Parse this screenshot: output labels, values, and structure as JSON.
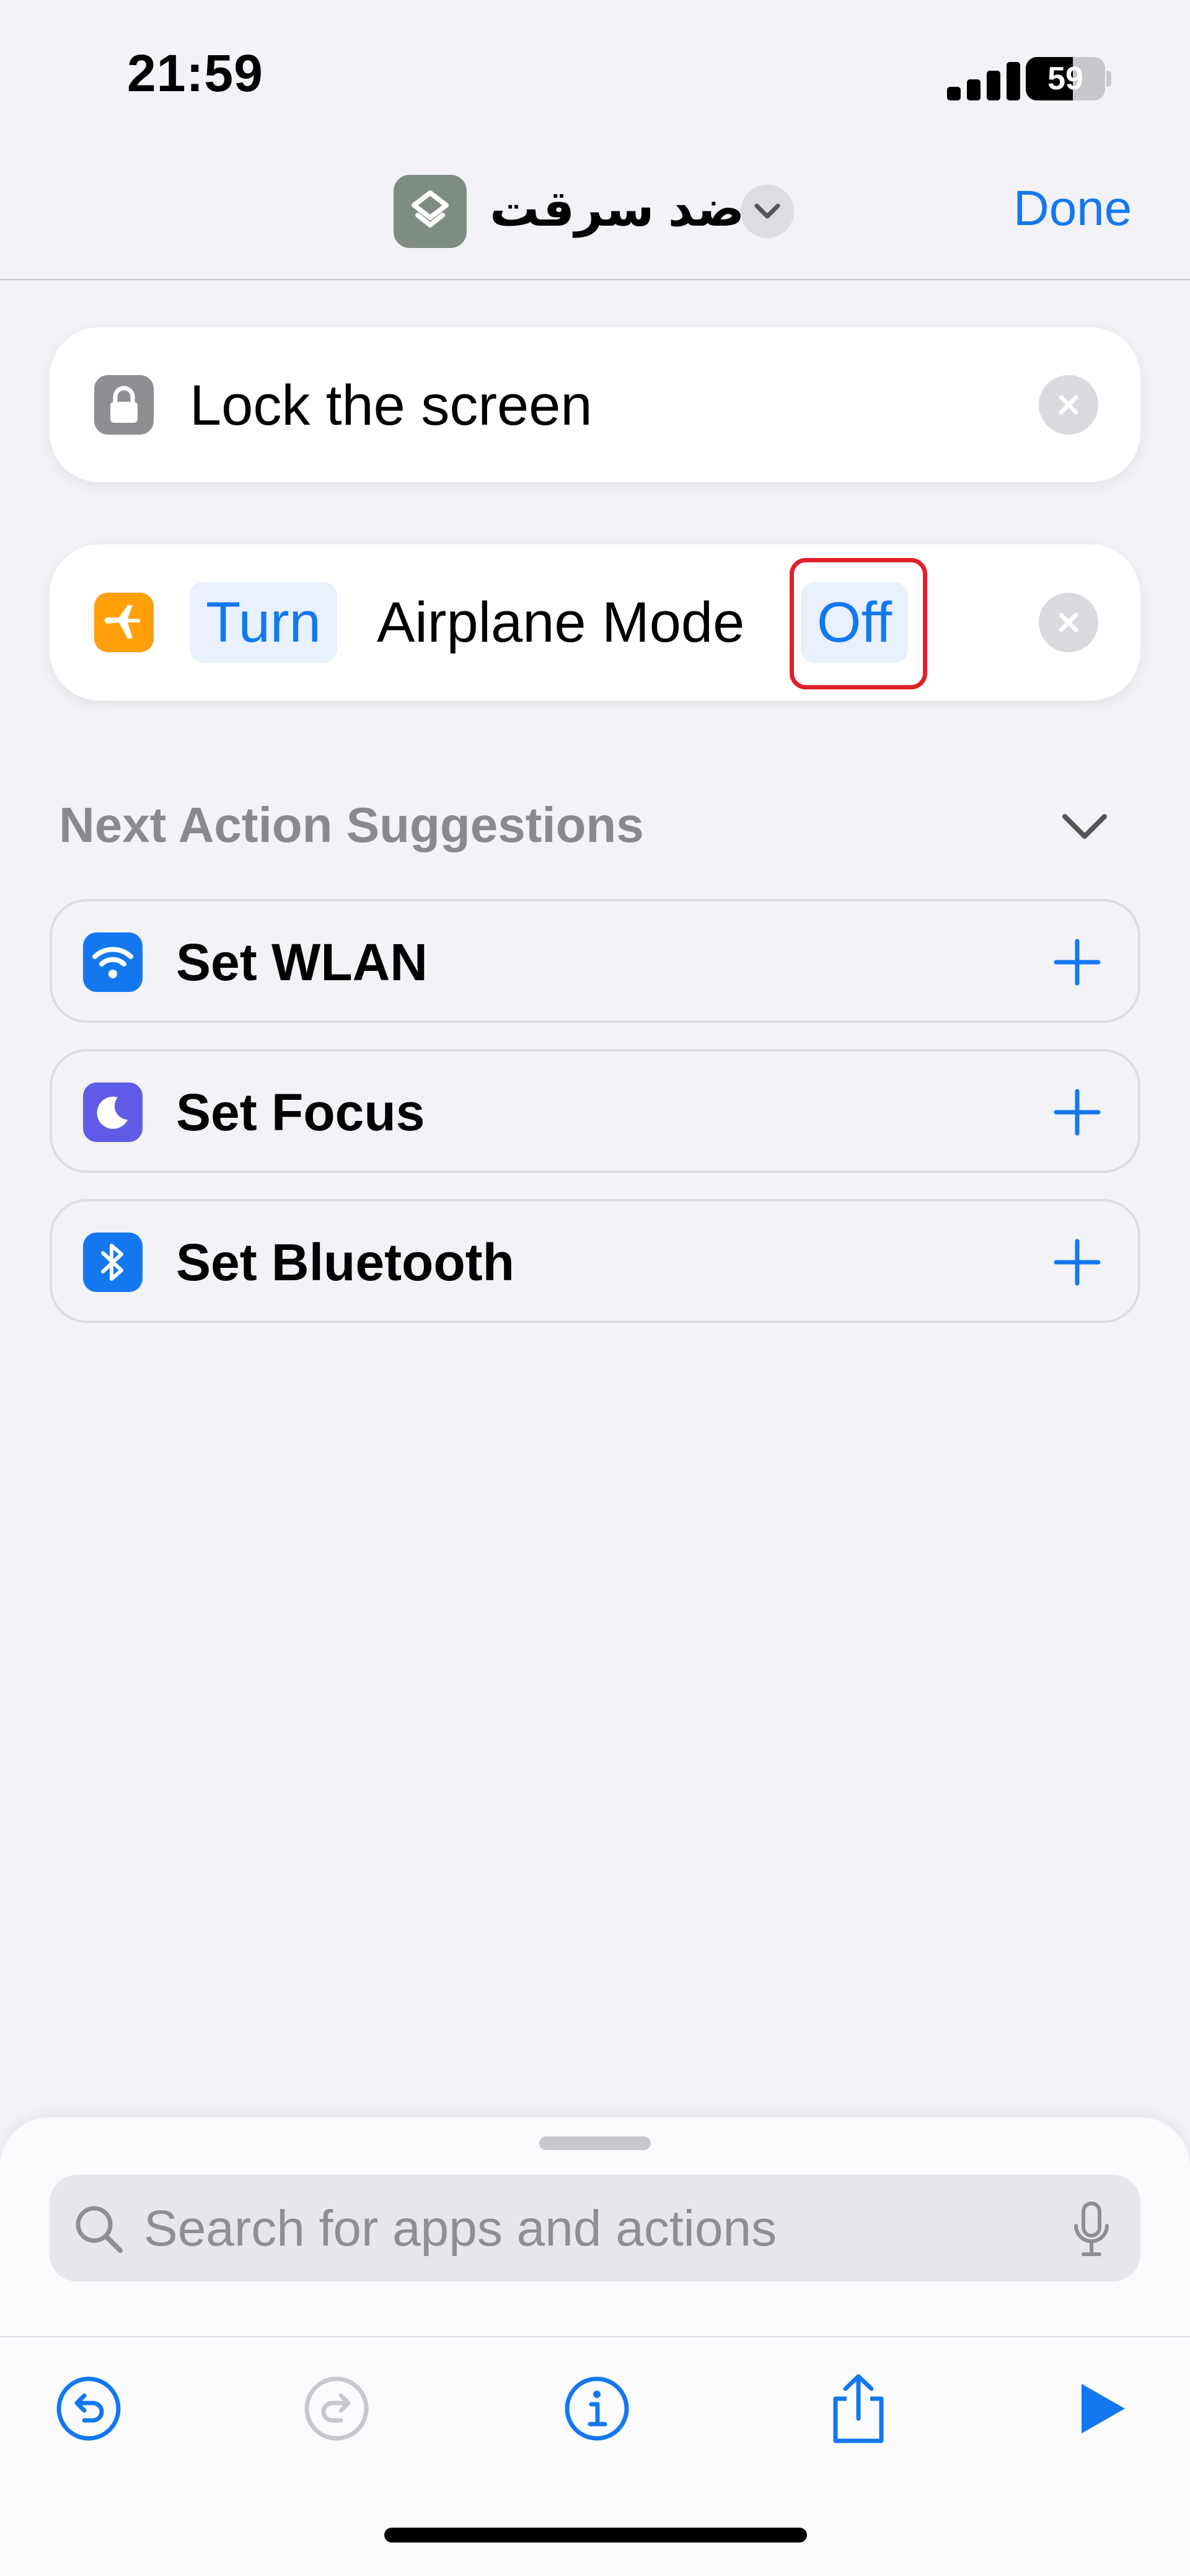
{
  "status_bar": {
    "time": "21:59",
    "battery_level": "59"
  },
  "nav": {
    "title": "ضد سرقت",
    "done_label": "Done"
  },
  "actions": [
    {
      "text": "Lock the screen"
    },
    {
      "verb_token": "Turn",
      "text": "Airplane Mode",
      "state_token": "Off"
    }
  ],
  "suggestions": {
    "header": "Next Action Suggestions",
    "items": [
      {
        "label": "Set WLAN",
        "icon": "wifi-icon",
        "color": "#1378f0"
      },
      {
        "label": "Set Focus",
        "icon": "moon-icon",
        "color": "#5e5ce6"
      },
      {
        "label": "Set Bluetooth",
        "icon": "bluetooth-icon",
        "color": "#1378f0"
      }
    ]
  },
  "search": {
    "placeholder": "Search for apps and actions"
  },
  "colors": {
    "accent": "#1378f0",
    "highlight": "#e0202a",
    "airplane": "#ff9f0a"
  }
}
